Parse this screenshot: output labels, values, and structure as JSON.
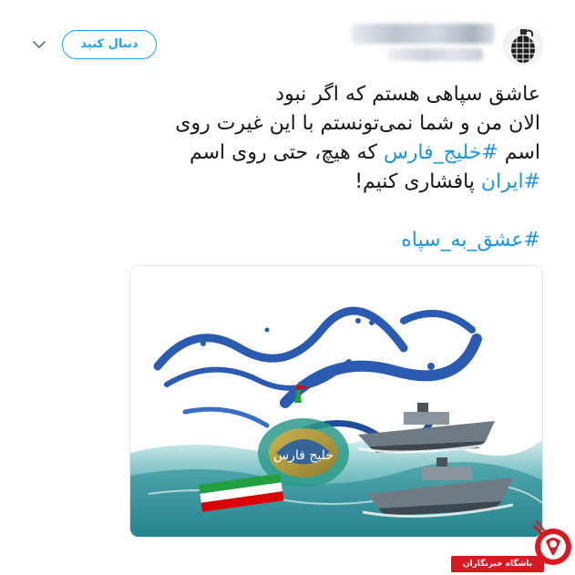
{
  "header": {
    "follow_label": "دنبال کنید"
  },
  "tweet": {
    "line1": "عاشق سپاهی هستم که اگر نبود",
    "line2": "الان من و شما نمی‌تونستم با این غیرت روی",
    "line3_prefix": "اسم ",
    "hashtag_gulf": "#خلیج_فارس",
    "line3_suffix": " که هیچ، حتی  روی اسم",
    "hashtag_iran": "#ایران",
    "line4_suffix": " پافشاری کنیم!",
    "hashtag_sepah": "#عشق_به_سپاه"
  },
  "media": {
    "calligraphy_text": "خلیج فارس"
  },
  "watermark": {
    "label": "باشگاه خبرنگاران"
  },
  "colors": {
    "accent": "#1da1f2",
    "hashtag": "#1b95e0",
    "text": "#14171a",
    "watermark_red": "#d71920"
  },
  "icons": {
    "more": "chevron-down-icon",
    "avatar": "grenade-icon",
    "watermark": "yjc-logo-icon"
  }
}
